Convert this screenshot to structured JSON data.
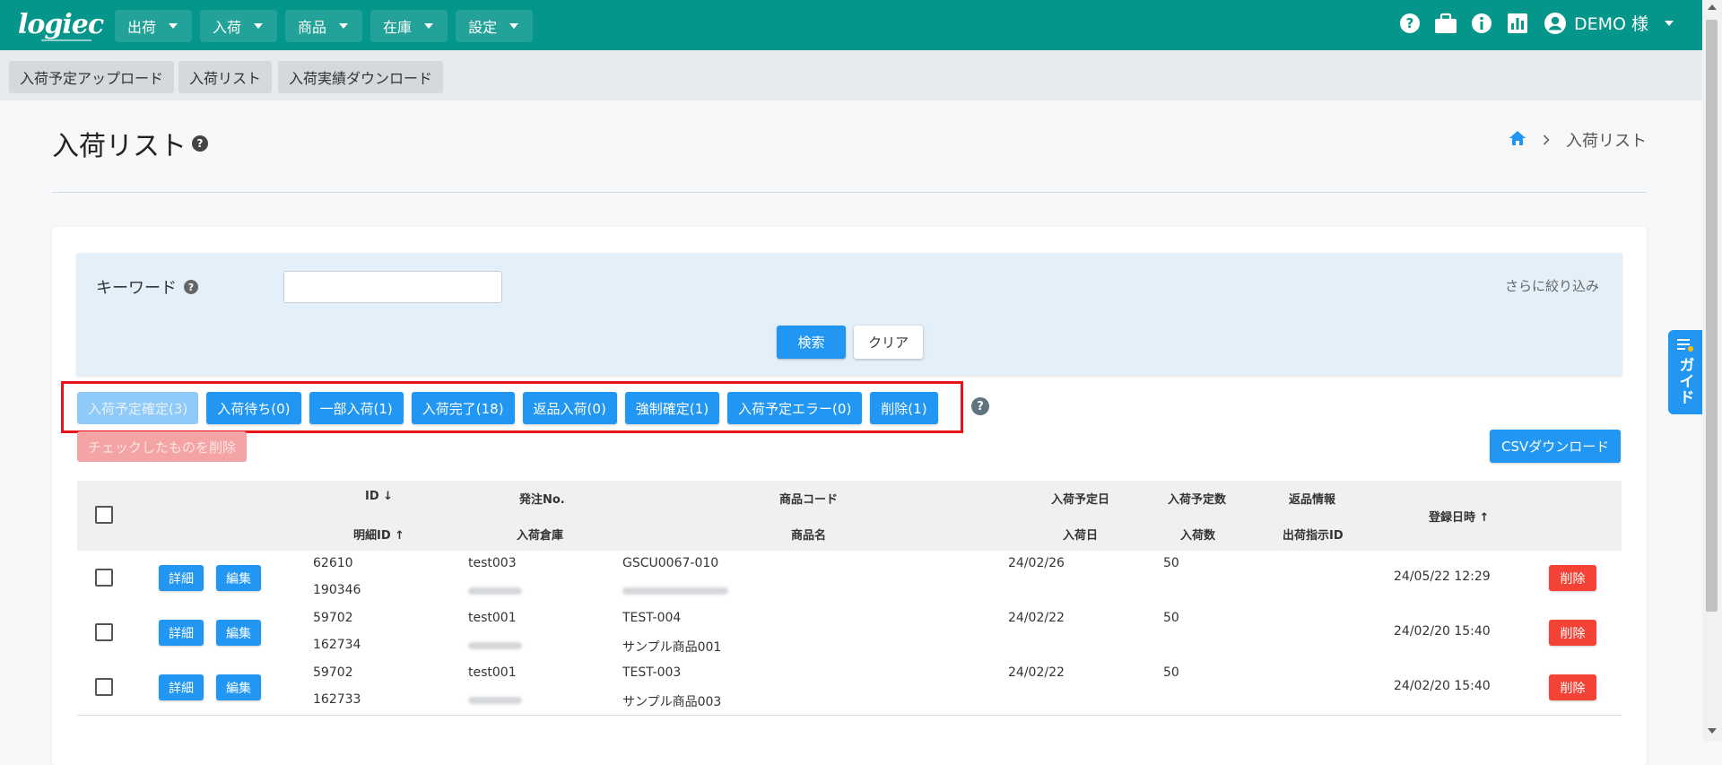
{
  "app": {
    "logo": "logiec"
  },
  "nav": [
    {
      "label": "出荷"
    },
    {
      "label": "入荷"
    },
    {
      "label": "商品"
    },
    {
      "label": "在庫"
    },
    {
      "label": "設定"
    }
  ],
  "user": {
    "name": "DEMO 様"
  },
  "subnav": [
    {
      "label": "入荷予定アップロード"
    },
    {
      "label": "入荷リスト"
    },
    {
      "label": "入荷実績ダウンロード"
    }
  ],
  "page": {
    "title": "入荷リスト",
    "breadcrumb_current": "入荷リスト"
  },
  "filter": {
    "keyword_label": "キーワード",
    "keyword_value": "",
    "refine_label": "さらに絞り込み",
    "search_label": "検索",
    "clear_label": "クリア"
  },
  "status_buttons": [
    {
      "label": "入荷予定確定(3)",
      "disabled": true
    },
    {
      "label": "入荷待ち(0)"
    },
    {
      "label": "一部入荷(1)"
    },
    {
      "label": "入荷完了(18)"
    },
    {
      "label": "返品入荷(0)"
    },
    {
      "label": "強制確定(1)"
    },
    {
      "label": "入荷予定エラー(0)"
    },
    {
      "label": "削除(1)"
    }
  ],
  "actions": {
    "delete_checked": "チェックしたものを削除",
    "csv_download": "CSVダウンロード"
  },
  "guide": {
    "label": "ガイド"
  },
  "table": {
    "headers": {
      "id": "ID",
      "detail_id": "明細ID",
      "order_no": "発注No.",
      "warehouse": "入荷倉庫",
      "product_code": "商品コード",
      "product_name": "商品名",
      "planned_date": "入荷予定日",
      "received_date": "入荷日",
      "planned_qty": "入荷予定数",
      "received_qty": "入荷数",
      "return_info": "返品情報",
      "ship_order_id": "出荷指示ID",
      "registered_at": "登録日時"
    },
    "row_buttons": {
      "detail": "詳細",
      "edit": "編集",
      "delete": "削除"
    },
    "rows": [
      {
        "id": "62610",
        "detail_id": "190346",
        "order_no": "test003",
        "product_code": "GSCU0067-010",
        "product_name": "",
        "planned_date": "24/02/26",
        "planned_qty": "50",
        "registered_at": "24/05/22 12:29"
      },
      {
        "id": "59702",
        "detail_id": "162734",
        "order_no": "test001",
        "product_code": "TEST-004",
        "product_name": "サンプル商品001",
        "planned_date": "24/02/22",
        "planned_qty": "50",
        "registered_at": "24/02/20 15:40"
      },
      {
        "id": "59702",
        "detail_id": "162733",
        "order_no": "test001",
        "product_code": "TEST-003",
        "product_name": "サンプル商品003",
        "planned_date": "24/02/22",
        "planned_qty": "50",
        "registered_at": "24/02/20 15:40"
      }
    ]
  },
  "colors": {
    "header_bg": "#04968a",
    "primary": "#2196f3",
    "danger": "#f44336",
    "highlight_box": "#e8141b"
  }
}
